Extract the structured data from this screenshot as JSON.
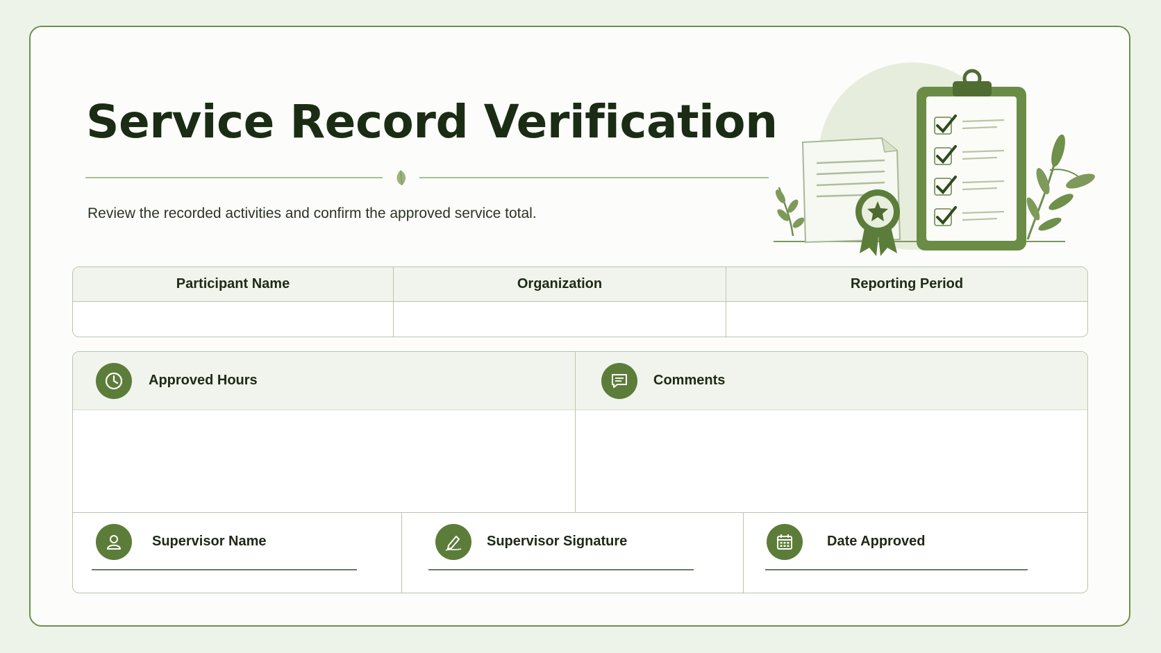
{
  "document": {
    "title": "Service Record Verification",
    "subtitle": "Review the recorded activities and confirm the approved service total."
  },
  "info_table": {
    "headers": [
      "Participant Name",
      "Organization",
      "Reporting Period"
    ],
    "values": [
      "",
      "",
      ""
    ]
  },
  "details": {
    "approved_hours": {
      "label": "Approved Hours",
      "icon": "clock-icon",
      "value": ""
    },
    "comments": {
      "label": "Comments",
      "icon": "comment-icon",
      "value": ""
    }
  },
  "signatures": [
    {
      "label": "Supervisor Name",
      "icon": "person-icon",
      "value": ""
    },
    {
      "label": "Supervisor Signature",
      "icon": "pen-icon",
      "value": ""
    },
    {
      "label": "Date Approved",
      "icon": "calendar-icon",
      "value": ""
    }
  ],
  "colors": {
    "accent": "#5c7d3a",
    "border": "#6e8f4e",
    "background": "#eef3ea",
    "header_fill": "#f1f4ec"
  }
}
